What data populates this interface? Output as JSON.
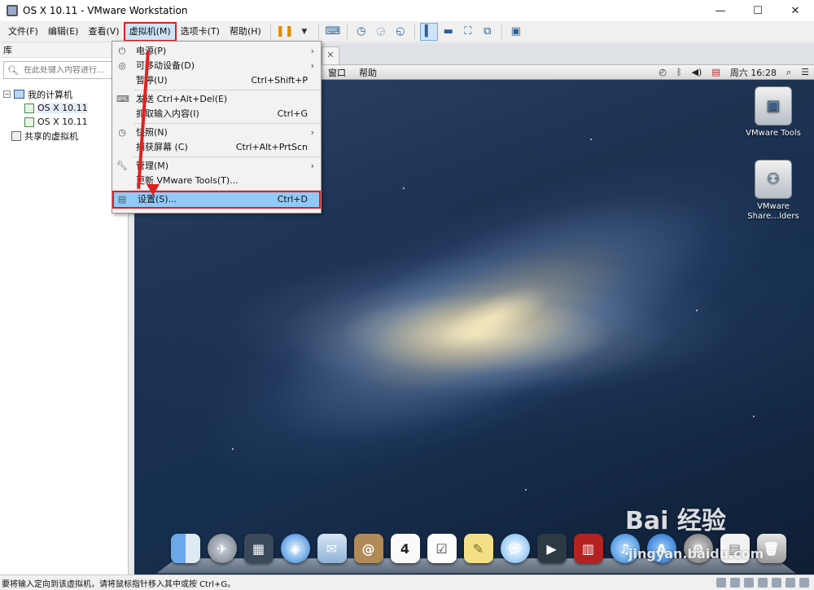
{
  "window": {
    "title": "OS X 10.11 - VMware Workstation",
    "min": "—",
    "max": "☐",
    "close": "✕"
  },
  "menubar": {
    "items": [
      "文件(F)",
      "编辑(E)",
      "查看(V)",
      "虚拟机(M)",
      "选项卡(T)",
      "帮助(H)"
    ]
  },
  "sidebar": {
    "header": "库",
    "search_placeholder": "在此处键入内容进行...",
    "tree": {
      "root": "我的计算机",
      "vms": [
        "OS X 10.11",
        "OS X 10.11"
      ],
      "shared": "共享的虚拟机"
    }
  },
  "dropdown": {
    "items": [
      {
        "label": "电源(P)",
        "shortcut": "",
        "submenu": true,
        "icon": "power-icon"
      },
      {
        "label": "可移动设备(D)",
        "shortcut": "",
        "submenu": true,
        "icon": "disc-icon"
      },
      {
        "label": "暂停(U)",
        "shortcut": "Ctrl+Shift+P",
        "submenu": false,
        "icon": ""
      },
      {
        "label": "发送 Ctrl+Alt+Del(E)",
        "shortcut": "",
        "submenu": false,
        "icon": "send-keys-icon"
      },
      {
        "label": "抓取输入内容(I)",
        "shortcut": "Ctrl+G",
        "submenu": false,
        "icon": ""
      },
      {
        "label": "快照(N)",
        "shortcut": "",
        "submenu": true,
        "icon": "snapshot-icon"
      },
      {
        "label": "捕获屏幕 (C)",
        "shortcut": "Ctrl+Alt+PrtScn",
        "submenu": false,
        "icon": ""
      },
      {
        "label": "管理(M)",
        "shortcut": "",
        "submenu": true,
        "icon": "wrench-icon"
      },
      {
        "label": "更新 VMware Tools(T)...",
        "shortcut": "",
        "submenu": false,
        "icon": ""
      },
      {
        "label": "设置(S)...",
        "shortcut": "Ctrl+D",
        "submenu": false,
        "icon": "settings-icon"
      }
    ],
    "arrow": "›"
  },
  "mac": {
    "menus": [
      "窗口",
      "帮助"
    ],
    "clock": "周六 16:28",
    "desktop_icons": [
      {
        "label1": "VMware Tools",
        "label2": ""
      },
      {
        "label1": "VMware",
        "label2": "Share…lders"
      }
    ]
  },
  "statusbar": {
    "text": "要将输入定向到该虚拟机，请将鼠标指针移入其中或按 Ctrl+G。"
  },
  "watermark": {
    "logo": "Bai 经验",
    "url": "jingyan.baidu.com"
  },
  "colors": {
    "highlight": "#91c9f7",
    "annotation_red": "#e02020",
    "menu_active": "#cce4f7"
  }
}
